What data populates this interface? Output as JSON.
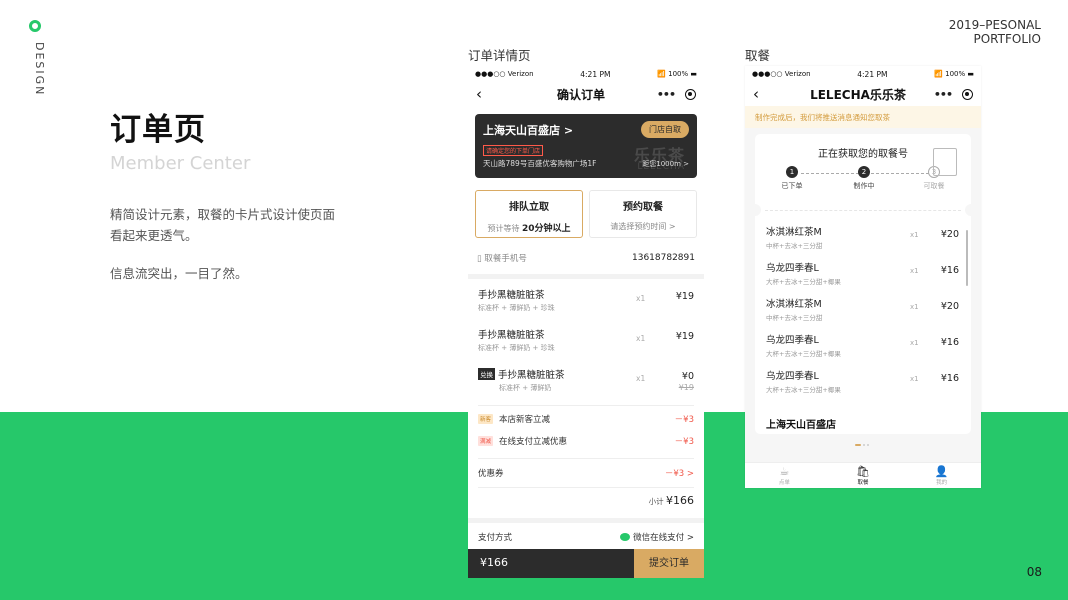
{
  "side": {
    "label": "DESIGN"
  },
  "portfolio": {
    "line1": "2019–PESONAL",
    "line2": "PORTFOLIO"
  },
  "page_number": "08",
  "hero": {
    "title": "订单页",
    "subtitle": "Member Center",
    "desc1": "精简设计元素，取餐的卡片式设计使页面看起来更透气。",
    "desc2": "信息流突出，一目了然。"
  },
  "captions": {
    "order": "订单详情页",
    "pickup": "取餐"
  },
  "status_bar": {
    "carrier": "●●●○○ Verizon",
    "time": "4:21 PM",
    "battery": "100%"
  },
  "order": {
    "nav_title": "确认订单",
    "store": {
      "name": "上海天山百盛店 >",
      "tag": "请确定您的下单门店",
      "address": "天山路789号百盛优客购物广场1F",
      "distance": "距您1000m >",
      "pickup_button": "门店自取",
      "watermark": "乐乐茶",
      "watermark_en": "LELECHA"
    },
    "mode_queue": {
      "title": "排队立取",
      "sub_prefix": "预计等待",
      "sub_value": "20分钟以上"
    },
    "mode_reserve": {
      "title": "预约取餐",
      "sub": "请选择预约时间 >"
    },
    "phone_label": "取餐手机号",
    "phone_number": "13618782891",
    "items": [
      {
        "name": "手抄黑糖脏脏茶",
        "spec": "标准杯 + 薄鲜奶 + 珍珠",
        "qty": "x1",
        "price": "¥19"
      },
      {
        "name": "手抄黑糖脏脏茶",
        "spec": "标准杯 + 薄鲜奶 + 珍珠",
        "qty": "x1",
        "price": "¥19"
      },
      {
        "badge": "兑换",
        "name": "手抄黑糖脏脏茶",
        "spec": "标准杯 + 薄鲜奶",
        "qty": "x1",
        "price": "¥0",
        "old_price": "¥19"
      }
    ],
    "promos": [
      {
        "tag": "新客",
        "label": "本店新客立减",
        "value": "－¥3"
      },
      {
        "tag": "满减",
        "label": "在线支付立减优惠",
        "value": "－¥3"
      }
    ],
    "coupon": {
      "label": "优惠券",
      "value": "－¥3 >"
    },
    "subtotal": {
      "label": "小计",
      "value": "¥166"
    },
    "payment": {
      "label": "支付方式",
      "value": "微信在线支付 >"
    },
    "bottom": {
      "total": "¥166",
      "submit": "提交订单"
    }
  },
  "pickup": {
    "nav_title": "LELECHA乐乐茶",
    "notice": "制作完成后，我们将推送消息通知您取茶",
    "card_title": "正在获取您的取餐号",
    "steps": [
      {
        "num": "1",
        "label": "已下单"
      },
      {
        "num": "2",
        "label": "制作中"
      },
      {
        "num": "3",
        "label": "可取餐"
      }
    ],
    "items": [
      {
        "name": "冰淇淋红茶M",
        "spec": "中杯+去冰+三分甜",
        "qty": "x1",
        "price": "¥20"
      },
      {
        "name": "乌龙四季春L",
        "spec": "大杯+去冰+三分甜+椰果",
        "qty": "x1",
        "price": "¥16"
      },
      {
        "name": "冰淇淋红茶M",
        "spec": "中杯+去冰+三分甜",
        "qty": "x1",
        "price": "¥20"
      },
      {
        "name": "乌龙四季春L",
        "spec": "大杯+去冰+三分甜+椰果",
        "qty": "x1",
        "price": "¥16"
      },
      {
        "name": "乌龙四季春L",
        "spec": "大杯+去冰+三分甜+椰果",
        "qty": "x1",
        "price": "¥16"
      }
    ],
    "store": "上海天山百盛店",
    "tabs": [
      {
        "icon": "☕",
        "label": "点单"
      },
      {
        "icon": "🛍",
        "label": "取餐"
      },
      {
        "icon": "👤",
        "label": "我的"
      }
    ]
  },
  "colors": {
    "accent_green": "#26c86a",
    "gold": "#d9aa63",
    "dark": "#2c2c2c",
    "red": "#f0584a"
  }
}
